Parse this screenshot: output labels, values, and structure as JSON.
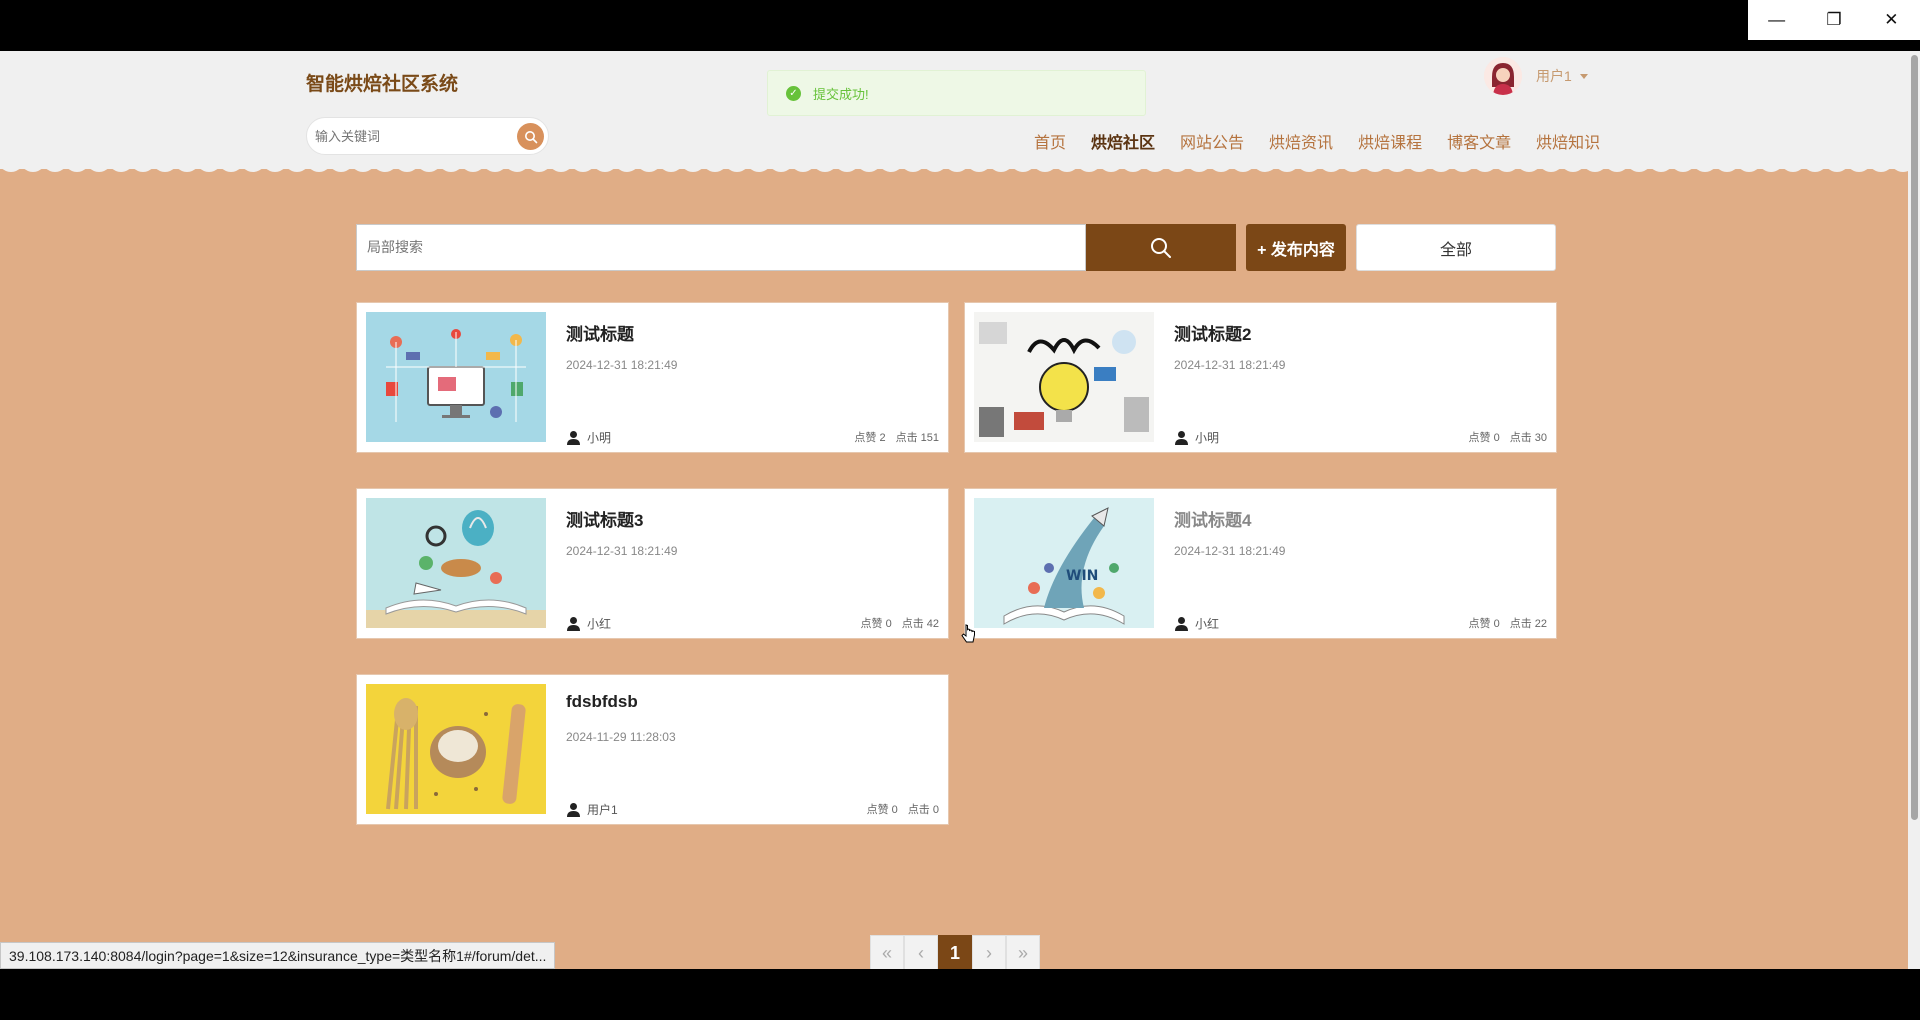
{
  "window": {
    "minimize": "—",
    "restore": "❐",
    "close": "✕"
  },
  "header": {
    "site_title": "智能烘焙社区系统",
    "search_placeholder": "输入关键词",
    "user_name": "用户1",
    "nav": [
      {
        "label": "首页",
        "active": false
      },
      {
        "label": "烘焙社区",
        "active": true
      },
      {
        "label": "网站公告",
        "active": false
      },
      {
        "label": "烘焙资讯",
        "active": false
      },
      {
        "label": "烘焙课程",
        "active": false
      },
      {
        "label": "博客文章",
        "active": false
      },
      {
        "label": "烘焙知识",
        "active": false
      }
    ]
  },
  "toast": {
    "message": "提交成功!",
    "type": "success"
  },
  "toolbar": {
    "local_search_placeholder": "局部搜索",
    "publish_label": "+ 发布内容",
    "all_label": "全部"
  },
  "posts": [
    {
      "title": "测试标题",
      "date": "2024-12-31 18:21:49",
      "author": "小明",
      "likes_label": "点赞 2",
      "clicks_label": "点击 151",
      "muted": false
    },
    {
      "title": "测试标题2",
      "date": "2024-12-31 18:21:49",
      "author": "小明",
      "likes_label": "点赞 0",
      "clicks_label": "点击 30",
      "muted": false
    },
    {
      "title": "测试标题3",
      "date": "2024-12-31 18:21:49",
      "author": "小红",
      "likes_label": "点赞 0",
      "clicks_label": "点击 42",
      "muted": false
    },
    {
      "title": "测试标题4",
      "date": "2024-12-31 18:21:49",
      "author": "小红",
      "likes_label": "点赞 0",
      "clicks_label": "点击 22",
      "muted": true
    },
    {
      "title": "fdsbfdsb",
      "date": "2024-11-29 11:28:03",
      "author": "用户1",
      "likes_label": "点赞 0",
      "clicks_label": "点击 0",
      "muted": false
    }
  ],
  "pagination": {
    "first": "«",
    "prev": "‹",
    "current": "1",
    "next": "›",
    "last": "»"
  },
  "status_url": "39.108.173.140:8084/login?page=1&size=12&insurance_type=类型名称1#/forum/det...",
  "colors": {
    "brand_brown": "#7b4716",
    "page_bg": "#e0ad86",
    "success": "#67c23a"
  }
}
